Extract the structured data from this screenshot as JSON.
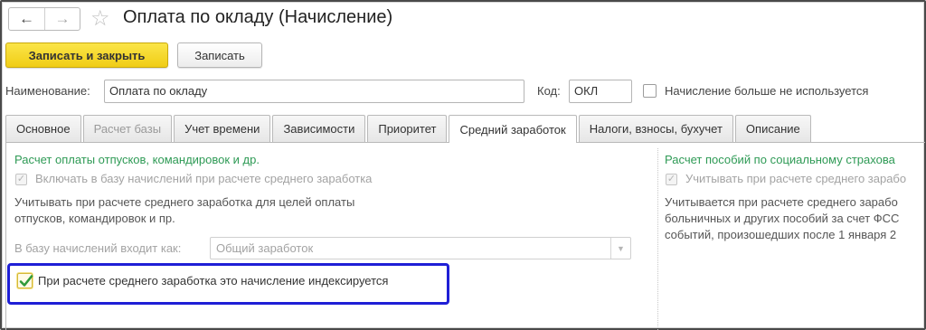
{
  "window": {
    "title": "Оплата по окладу (Начисление)"
  },
  "nav": {
    "back_icon": "arrow-left-icon",
    "forward_icon": "arrow-right-icon",
    "favorite_icon": "star-icon"
  },
  "toolbar": {
    "save_close_label": "Записать и закрыть",
    "save_label": "Записать"
  },
  "header": {
    "name_label": "Наименование:",
    "name_value": "Оплата по окладу",
    "code_label": "Код:",
    "code_value": "ОКЛ",
    "unused_label": "Начисление больше не используется",
    "unused_checked": false
  },
  "tabs": [
    {
      "label": "Основное",
      "state": "normal"
    },
    {
      "label": "Расчет базы",
      "state": "disabled"
    },
    {
      "label": "Учет времени",
      "state": "normal"
    },
    {
      "label": "Зависимости",
      "state": "normal"
    },
    {
      "label": "Приоритет",
      "state": "normal"
    },
    {
      "label": "Средний заработок",
      "state": "active"
    },
    {
      "label": "Налоги, взносы, бухучет",
      "state": "normal"
    },
    {
      "label": "Описание",
      "state": "normal"
    }
  ],
  "left": {
    "section_title": "Расчет оплаты отпусков, командировок и др.",
    "include_base_label": "Включать в базу начислений при расчете среднего заработка",
    "include_base_checked": true,
    "hint_line1": "Учитывать при расчете среднего заработка для целей оплаты",
    "hint_line2": "отпусков, командировок и пр.",
    "base_kind_label": "В базу начислений входит как:",
    "base_kind_value": "Общий заработок",
    "indexed_label": "При расчете среднего заработка это начисление индексируется",
    "indexed_checked": true
  },
  "right": {
    "section_title": "Расчет пособий по социальному страхова",
    "consider_label": "Учитывать при расчете среднего зарабо",
    "consider_checked": true,
    "hint_line1": "Учитывается при расчете среднего зарабо",
    "hint_line2": "больничных и других пособий за счет ФСС",
    "hint_line3": "событий, произошедших после 1 января 2"
  },
  "colors": {
    "primary_button": "#f5d82a",
    "section_title": "#2e9a55",
    "highlight_border": "#1f1fd6",
    "checkmark": "#2f9a3a"
  }
}
